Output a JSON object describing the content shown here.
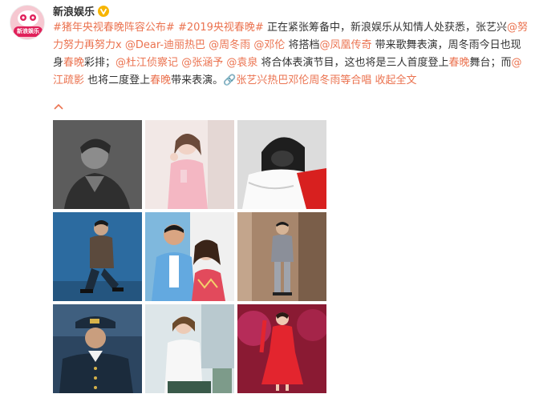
{
  "account": {
    "name": "新浪娱乐",
    "avatar_text": "新浪娱乐",
    "verified_icon": "verified-v-icon",
    "brand_color": "#eb7350"
  },
  "post": {
    "segments": [
      {
        "type": "tag",
        "text": "#猪年央视春晚阵容公布#"
      },
      {
        "type": "text",
        "text": " "
      },
      {
        "type": "tag",
        "text": "#2019央视春晚#"
      },
      {
        "type": "text",
        "text": " 正在紧张筹备中，新浪娱乐从知情人处获悉，张艺兴"
      },
      {
        "type": "mention",
        "text": "@努力努力再努力x"
      },
      {
        "type": "text",
        "text": " "
      },
      {
        "type": "mention",
        "text": "@Dear-迪丽热巴"
      },
      {
        "type": "text",
        "text": " "
      },
      {
        "type": "mention",
        "text": "@周冬雨"
      },
      {
        "type": "text",
        "text": " "
      },
      {
        "type": "mention",
        "text": "@邓伦"
      },
      {
        "type": "text",
        "text": " 将搭档"
      },
      {
        "type": "mention",
        "text": "@凤凰传奇"
      },
      {
        "type": "text",
        "text": " 带来歌舞表演，周冬雨今日也现身"
      },
      {
        "type": "kw",
        "text": "春晚"
      },
      {
        "type": "text",
        "text": "彩排；"
      },
      {
        "type": "mention",
        "text": "@杜江侦察记"
      },
      {
        "type": "text",
        "text": " "
      },
      {
        "type": "mention",
        "text": "@张涵予"
      },
      {
        "type": "text",
        "text": " "
      },
      {
        "type": "mention",
        "text": "@袁泉"
      },
      {
        "type": "text",
        "text": " 将合体表演节目，这也将是三人首度登上"
      },
      {
        "type": "kw",
        "text": "春晚"
      },
      {
        "type": "text",
        "text": "舞台；而"
      },
      {
        "type": "mention",
        "text": "@江疏影"
      },
      {
        "type": "text",
        "text": " 也将二度登上"
      },
      {
        "type": "kw",
        "text": "春晚"
      },
      {
        "type": "text",
        "text": "带来表演。"
      },
      {
        "type": "link",
        "text": "🔗张艺兴热巴邓伦周冬雨等合唱"
      },
      {
        "type": "text",
        "text": " "
      },
      {
        "type": "expand",
        "text": "收起全文"
      }
    ],
    "collapse_icon": "chevron-up-icon"
  },
  "photos": [
    {
      "name": "photo-1",
      "icon": "portrait-photo",
      "bg": "#5a5a5a"
    },
    {
      "name": "photo-2",
      "icon": "portrait-photo",
      "bg": "#efe4e2"
    },
    {
      "name": "photo-3",
      "icon": "portrait-photo",
      "bg": "#d9d9d9"
    },
    {
      "name": "photo-4",
      "icon": "portrait-photo",
      "bg": "#2f6fa3"
    },
    {
      "name": "photo-5",
      "icon": "portrait-photo",
      "bg": "#e86a7a"
    },
    {
      "name": "photo-6",
      "icon": "portrait-photo",
      "bg": "#9a7a63"
    },
    {
      "name": "photo-7",
      "icon": "portrait-photo",
      "bg": "#2e4560"
    },
    {
      "name": "photo-8",
      "icon": "portrait-photo",
      "bg": "#d8e1e4"
    },
    {
      "name": "photo-9",
      "icon": "portrait-photo",
      "bg": "#a5213a"
    }
  ]
}
